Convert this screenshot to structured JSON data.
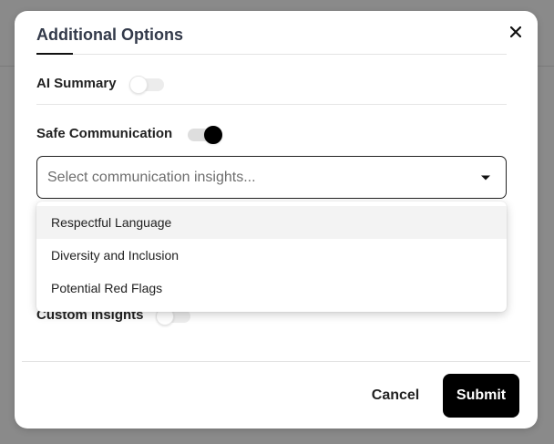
{
  "modal": {
    "title": "Additional Options"
  },
  "options": {
    "ai_summary": {
      "label": "AI Summary",
      "enabled": false
    },
    "safe_communication": {
      "label": "Safe Communication",
      "enabled": true
    },
    "custom_insights": {
      "label": "Custom Insights",
      "enabled": false
    }
  },
  "insights_select": {
    "placeholder": "Select communication insights...",
    "options": [
      "Respectful Language",
      "Diversity and Inclusion",
      "Potential Red Flags"
    ],
    "highlighted_index": 0
  },
  "footer": {
    "cancel_label": "Cancel",
    "submit_label": "Submit"
  },
  "colors": {
    "backdrop": "#8a8a8a",
    "primary": "#000000",
    "title": "#333a4a"
  }
}
